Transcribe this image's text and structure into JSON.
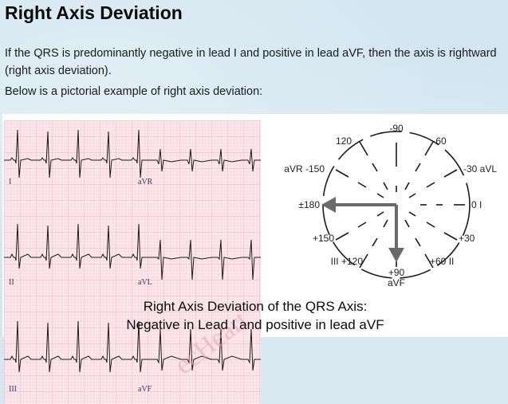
{
  "page": {
    "title": "Right Axis Deviation",
    "paragraph1": "If the QRS is predominantly negative in lead I and positive in lead aVF, then the axis is rightward (right axis deviation).",
    "paragraph2": "Below is a pictorial example of right axis deviation:"
  },
  "figure": {
    "ecg_leads": {
      "row1_left": "I",
      "row1_right": "aVR",
      "row2_left": "II",
      "row2_right": "aVL",
      "row3_left": "III",
      "row3_right": "aVF"
    },
    "watermark": "ecHeart",
    "axis_labels": {
      "top": "-90",
      "upper_left": "120",
      "upper_right": "-60",
      "avr": "aVR -150",
      "avl": "-30 aVL",
      "left": "±180",
      "right": "0 I",
      "lower_left": "+150",
      "lower_right": "+30",
      "bottom_left": "III +120",
      "bottom": "+90",
      "bottom_right": "+60 II",
      "avf": "aVF"
    },
    "caption_line1": "Right Axis Deviation of the QRS Axis:",
    "caption_line2": "Negative in Lead I and positive in lead aVF"
  },
  "colors": {
    "page_background": "#d3e6f0",
    "ecg_grid": "#f1b6c8",
    "arrow": "#6a6a6a"
  }
}
